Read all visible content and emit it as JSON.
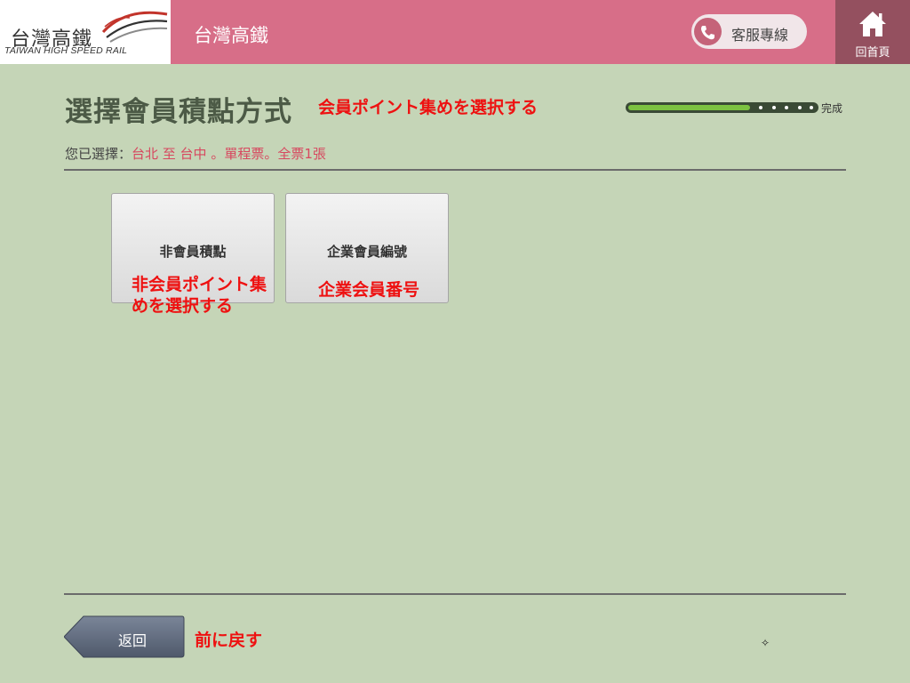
{
  "header": {
    "logo_cn": "台灣高鐵",
    "logo_en": "TAIWAN HIGH SPEED RAIL",
    "title": "台灣高鐵",
    "service_label": "客服專線",
    "home_label": "回首頁",
    "icons": {
      "service": "phone-icon",
      "home": "home-icon"
    }
  },
  "page": {
    "title": "選擇會員積點方式",
    "jp_title": "会員ポイント集めを選択する"
  },
  "progress": {
    "label": "完成",
    "fraction": 0.65
  },
  "selection": {
    "prefix": "您已選擇：",
    "value": "台北 至 台中 。單程票。全票1張"
  },
  "options": [
    {
      "label": "非會員積點",
      "jp": "非会員ポイント集めを選択する"
    },
    {
      "label": "企業會員編號",
      "jp": "企業会員番号"
    }
  ],
  "footer": {
    "back_label": "返回",
    "jp_back": "前に戻す"
  },
  "colors": {
    "background": "#c5d5b7",
    "header": "#d76e88",
    "home_button": "#94505f",
    "progress_fill": "#7cc241",
    "annotation_red": "#ee1111"
  }
}
